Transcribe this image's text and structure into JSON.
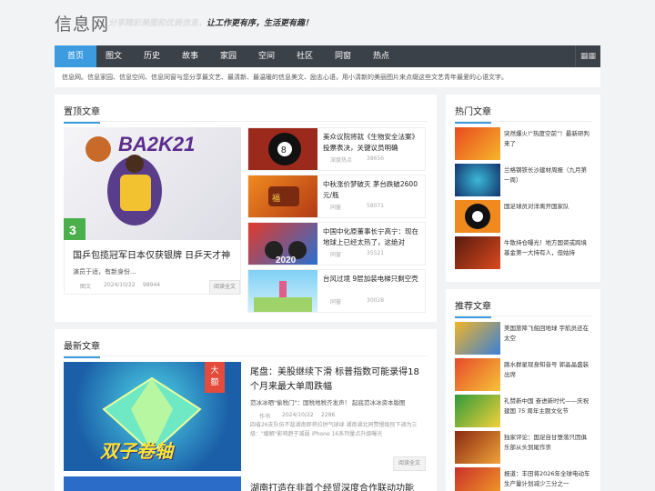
{
  "header": {
    "logo": "信息网",
    "slogan_light": "分享精彩美图和优美信息，",
    "slogan_dark": "让工作更有序，生活更有趣！"
  },
  "nav": {
    "items": [
      "首页",
      "图文",
      "历史",
      "故事",
      "家园",
      "空间",
      "社区",
      "同窗",
      "热点"
    ],
    "active_index": 0,
    "grid_icon": "grid-icon"
  },
  "intro": "信息网。信息家园、信息空间、信息同窗与您分享最文艺、最清新、最温暖的信息美文、励志心语，用小清新的美丽图片来点缀这些文艺青年最爱的心语文字。",
  "top": {
    "title": "置顶文章",
    "feature": {
      "title": "国乒包揽冠军日本仅获银牌 日乒天才神",
      "excerpt": "演员于适，有新身份...",
      "category": "图文",
      "date": "2024/10/22",
      "views": "98944",
      "button": "阅读全文"
    },
    "items": [
      {
        "title": "美众议院将就《生物安全法案》投票表决，关键议员明确",
        "category": "深度热点",
        "views": "38656"
      },
      {
        "title": "中秋涨价梦破灭 茅台跌破2600元/瓶",
        "category": "同窗",
        "views": "58071"
      },
      {
        "title": "中国中化原董事长宁高宁：现在地球上已经太热了，这绝对",
        "category": "同窗",
        "views": "35521"
      },
      {
        "title": "台风过境 9层加装电梯只剩空壳",
        "category": "同窗",
        "views": "30028"
      }
    ]
  },
  "latest": {
    "title": "最新文章",
    "article": {
      "badge": "大额",
      "title": "尾盘：美股继续下滑 标普指数可能录得18个月来最大单周跌幅",
      "subtitle": "范冰冰晒\"偷税门\"：国税地税齐发声！ 起底范冰冰资本版图",
      "author": "作书",
      "date": "2024/10/22",
      "views": "2286",
      "snippet": "四省26支队伍不敌湖南即将拉拼气球球 湖南湖北同赞慢级别下调为三级：\"缓解\"影响趋于减弱 iPhone 16系列量点升级曝光",
      "button": "阅读全文",
      "image_text": "双子卷轴"
    },
    "second_title": "湖南打造在非首个经贸深度合作联动功能"
  },
  "hot": {
    "title": "热门文章",
    "items": [
      "突然爆火!“热度空前”！最新研判来了",
      "兰格钢铁长沙建材周报（九月第一周）",
      "国足球员对洋离开国家队",
      "牛散持仓曝光！地方国资或跨境基金第一大持有人，但姑持"
    ]
  },
  "recommend": {
    "title": "推荐文章",
    "items": [
      "美国旅降飞船回地球 宇航员还在太空",
      "路水群星现身知音号 郭晶晶盛装出席",
      "礼赞新中国 奋进新时代——庆祝建国 75 周年主题文化节",
      "独家评论：国足自甘堕落只因俱乐部从头到尾作祟",
      "报道：丰田将2026年全球电动车生产量计划减少三分之一"
    ]
  },
  "colors": {
    "accent": "#3d9ce0",
    "nav_bg": "#3b4149",
    "badge": "#e54b3d"
  }
}
